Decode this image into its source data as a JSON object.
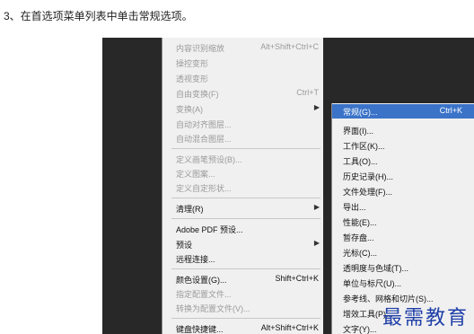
{
  "caption": "3、在首选项菜单列表中单击常规选项。",
  "menu": [
    {
      "label": "内容识别缩放",
      "shortcut": "Alt+Shift+Ctrl+C",
      "disabled": true
    },
    {
      "label": "操控变形",
      "shortcut": "",
      "disabled": true
    },
    {
      "label": "透视变形",
      "shortcut": "",
      "disabled": true
    },
    {
      "label": "自由变换(F)",
      "shortcut": "Ctrl+T",
      "disabled": true
    },
    {
      "label": "变换(A)",
      "shortcut": "",
      "disabled": true,
      "submenu": true
    },
    {
      "label": "自动对齐图层...",
      "shortcut": "",
      "disabled": true
    },
    {
      "label": "自动混合图层...",
      "shortcut": "",
      "disabled": true
    },
    {
      "label": "定义画笔预设(B)...",
      "shortcut": "",
      "disabled": true
    },
    {
      "label": "定义图案...",
      "shortcut": "",
      "disabled": true
    },
    {
      "label": "定义自定形状...",
      "shortcut": "",
      "disabled": true
    },
    {
      "label": "清理(R)",
      "shortcut": "",
      "disabled": false,
      "submenu": true
    },
    {
      "label": "Adobe PDF 预设...",
      "shortcut": "",
      "disabled": false
    },
    {
      "label": "预设",
      "shortcut": "",
      "disabled": false,
      "submenu": true
    },
    {
      "label": "远程连接...",
      "shortcut": "",
      "disabled": false
    },
    {
      "label": "颜色设置(G)...",
      "shortcut": "Shift+Ctrl+K",
      "disabled": false
    },
    {
      "label": "指定配置文件...",
      "shortcut": "",
      "disabled": true
    },
    {
      "label": "转换为配置文件(V)...",
      "shortcut": "",
      "disabled": true
    },
    {
      "label": "键盘快捷键...",
      "shortcut": "Alt+Shift+Ctrl+K",
      "disabled": false
    }
  ],
  "submenu": [
    {
      "label": "常规(G)...",
      "shortcut": "Ctrl+K",
      "highlighted": true
    },
    {
      "label": "界面(I)...",
      "shortcut": ""
    },
    {
      "label": "工作区(K)...",
      "shortcut": ""
    },
    {
      "label": "工具(O)...",
      "shortcut": ""
    },
    {
      "label": "历史记录(H)...",
      "shortcut": ""
    },
    {
      "label": "文件处理(F)...",
      "shortcut": ""
    },
    {
      "label": "导出...",
      "shortcut": ""
    },
    {
      "label": "性能(E)...",
      "shortcut": ""
    },
    {
      "label": "暂存盘...",
      "shortcut": ""
    },
    {
      "label": "光标(C)...",
      "shortcut": ""
    },
    {
      "label": "透明度与色域(T)...",
      "shortcut": ""
    },
    {
      "label": "单位与标尺(U)...",
      "shortcut": ""
    },
    {
      "label": "参考线、网格和切片(S)...",
      "shortcut": ""
    },
    {
      "label": "增效工具(P)...",
      "shortcut": ""
    },
    {
      "label": "文字(Y)...",
      "shortcut": ""
    }
  ],
  "watermark": "最需教育",
  "colors": {
    "highlight": "#3a73c8",
    "menu_bg": "#f0f0f0",
    "backdrop": "#282828",
    "watermark": "#1f3fa8"
  }
}
